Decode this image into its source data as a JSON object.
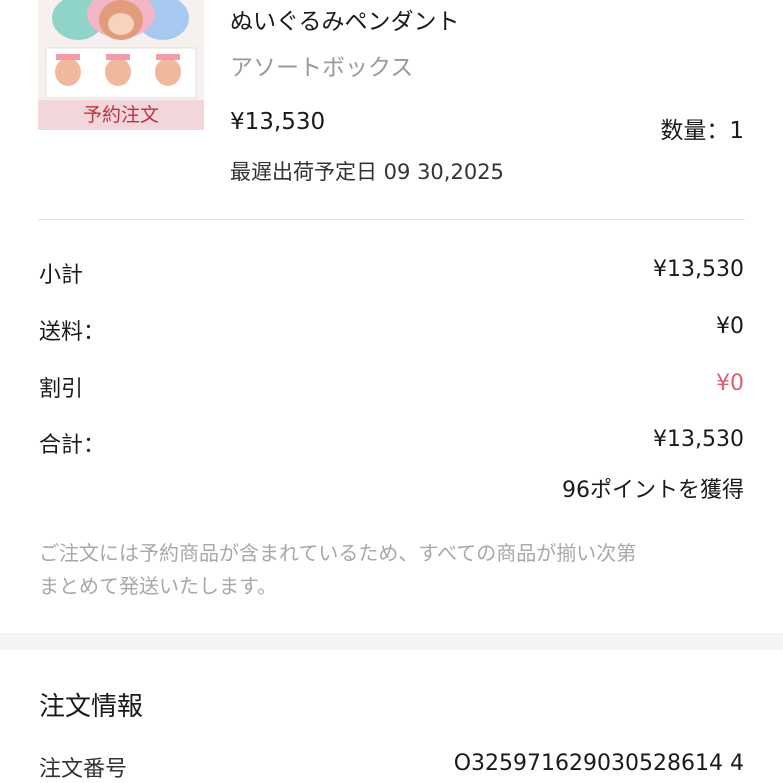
{
  "product": {
    "badge": "予約注文",
    "name": "ぬいぐるみペンダント",
    "variant": "アソートボックス",
    "price": "¥13,530",
    "quantity": "数量：1",
    "ship_date": "最遅出荷予定日 09 30,2025"
  },
  "summary": {
    "subtotal_label": "小計",
    "subtotal_value": "¥13,530",
    "shipping_label": "送料：",
    "shipping_value": "¥0",
    "discount_label": "割引",
    "discount_value": "¥0",
    "total_label": "合計：",
    "total_value": "¥13,530",
    "points": "96ポイントを獲得"
  },
  "note": {
    "line1": "ご注文には予約商品が含まれているため、すべての商品が揃い次第",
    "line2": "まとめて発送いたします。"
  },
  "order_info": {
    "title": "注文情報",
    "number_label": "注文番号",
    "number_value": "O325971629030528614 4"
  },
  "colors": {
    "discount": "#d8606f",
    "badge_bg": "#f1d7dc",
    "badge_text": "#c0323f",
    "muted": "#a8a8a8"
  }
}
